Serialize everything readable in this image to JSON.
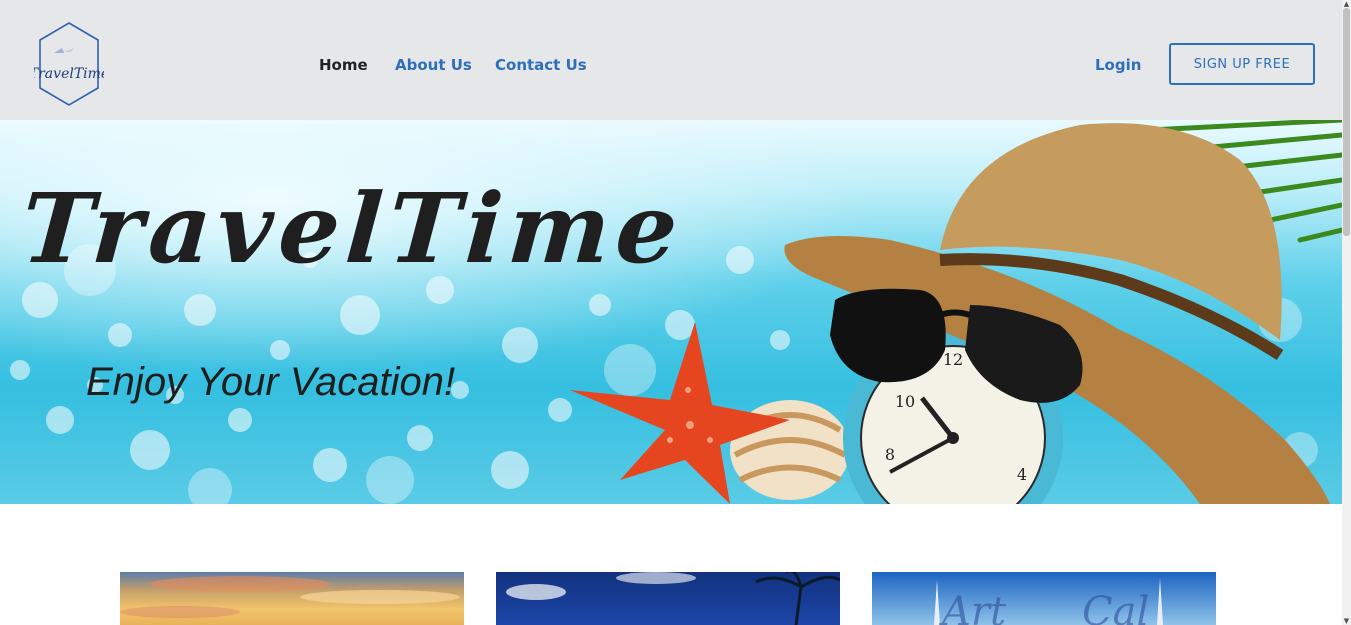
{
  "brand": {
    "logo_text": "TravelTime",
    "logo_icon": "airplane-hexagon-logo"
  },
  "nav": {
    "items": [
      {
        "label": "Home",
        "active": true
      },
      {
        "label": "About Us",
        "active": false
      },
      {
        "label": "Contact Us",
        "active": false
      }
    ],
    "login_label": "Login",
    "signup_label": "SIGN UP FREE"
  },
  "hero": {
    "title": "TravelTime",
    "subtitle": "Enjoy Your Vacation!"
  },
  "colors": {
    "accent": "#2e6fba",
    "header_bg": "#e6e7e9",
    "text_dark": "#222222"
  },
  "cards": [
    {
      "image": "sunset-sky-image"
    },
    {
      "image": "tropical-palm-image"
    },
    {
      "image": "mosque-minaret-image"
    }
  ]
}
